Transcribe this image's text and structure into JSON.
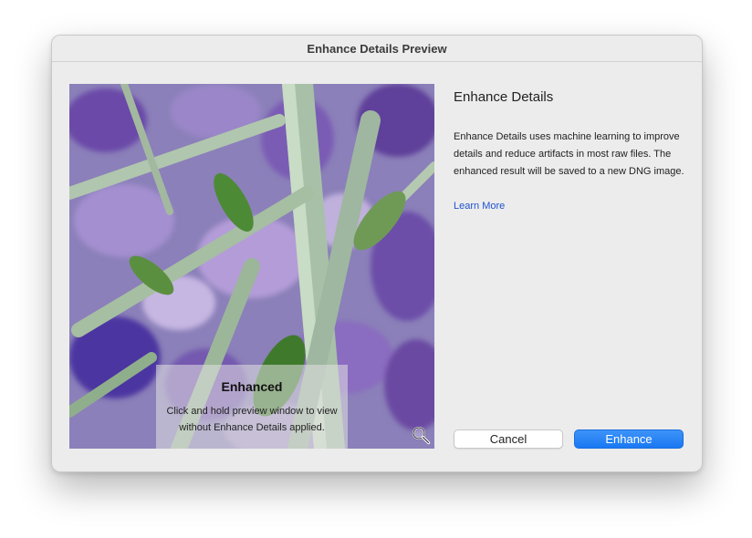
{
  "window": {
    "title": "Enhance Details Preview"
  },
  "preview": {
    "overlay_title": "Enhanced",
    "overlay_text": "Click and hold preview window to view without Enhance Details applied.",
    "zoom_icon": "magnifier-zoom-icon"
  },
  "panel": {
    "title": "Enhance Details",
    "description": "Enhance Details uses machine learning to improve details and reduce artifacts in most raw files. The enhanced result will be saved to a new DNG image.",
    "learn_more": "Learn More"
  },
  "buttons": {
    "cancel": "Cancel",
    "enhance": "Enhance"
  },
  "colors": {
    "accent": "#1a78f2",
    "link": "#1e52d0",
    "window_bg": "#ececec"
  }
}
